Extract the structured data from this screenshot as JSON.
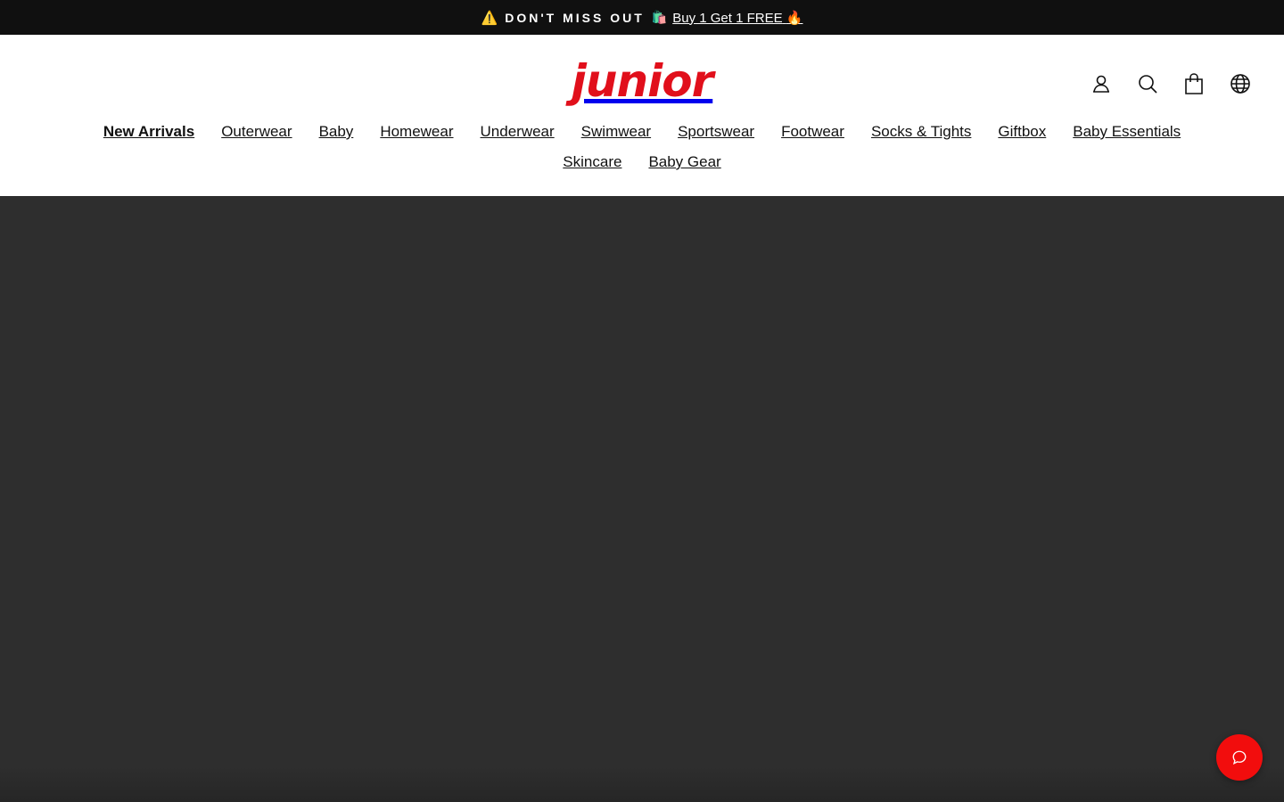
{
  "announcement": {
    "warn_glyph": "⚠️",
    "headline": "DON'T MISS OUT",
    "bag_glyph": "🛍️",
    "link_text": "Buy 1 Get 1 FREE",
    "fire_glyph": "🔥"
  },
  "brand": {
    "logo_text": "junior",
    "logo_color": "#e10f1b"
  },
  "header_icons": [
    {
      "name": "account-icon"
    },
    {
      "name": "search-icon"
    },
    {
      "name": "cart-icon"
    },
    {
      "name": "globe-icon"
    }
  ],
  "nav": {
    "items": [
      {
        "label": "New Arrivals"
      },
      {
        "label": "Outerwear"
      },
      {
        "label": "Baby"
      },
      {
        "label": "Homewear"
      },
      {
        "label": "Underwear"
      },
      {
        "label": "Swimwear"
      },
      {
        "label": "Sportswear"
      },
      {
        "label": "Footwear"
      },
      {
        "label": "Socks & Tights"
      },
      {
        "label": "Giftbox"
      },
      {
        "label": "Baby Essentials"
      },
      {
        "label": "Skincare"
      },
      {
        "label": "Baby Gear"
      }
    ]
  },
  "chat": {
    "icon": "chat-bubble-icon",
    "color": "#f20d0d"
  },
  "colors": {
    "announcement_bg": "#101010",
    "hero_bg": "#2e2e2e"
  }
}
